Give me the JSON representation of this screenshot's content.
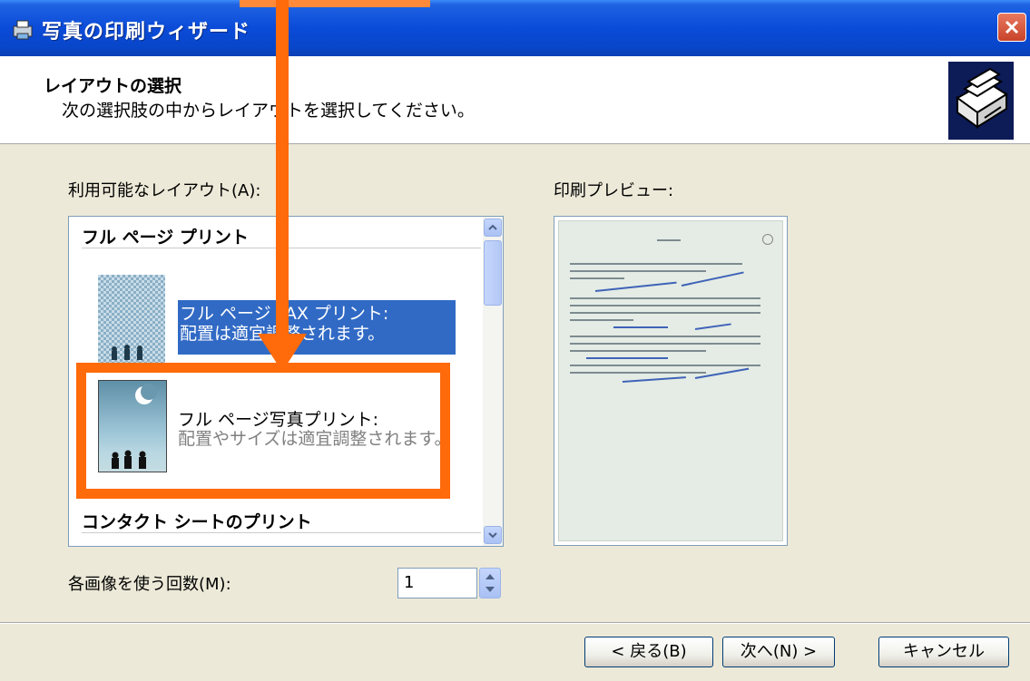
{
  "window": {
    "title": "写真の印刷ウィザード"
  },
  "header": {
    "title": "レイアウトの選択",
    "subtitle": "次の選択肢の中からレイアウトを選択してください。"
  },
  "layouts": {
    "label": "利用可能なレイアウト(A):",
    "categories": [
      {
        "label": "フル ページ プリント"
      },
      {
        "label": "コンタクト シートのプリント"
      }
    ],
    "items": [
      {
        "title": "フル ページ FAX プリント:",
        "description": "配置は適宜調整されます。",
        "selected": true
      },
      {
        "title": "フル ページ写真プリント:",
        "description": "配置やサイズは適宜調整されます。",
        "selected": false
      }
    ]
  },
  "preview": {
    "label": "印刷プレビュー:"
  },
  "copies": {
    "label": "各画像を使う回数(M):",
    "value": "1"
  },
  "buttons": {
    "back": "< 戻る(B)",
    "next": "次へ(N) >",
    "cancel": "キャンセル"
  },
  "colors": {
    "titlebar": "#0A4BD8",
    "selection": "#316AC5",
    "annotation": "#FF6A0A",
    "dialog_bg": "#ECE9D8"
  }
}
